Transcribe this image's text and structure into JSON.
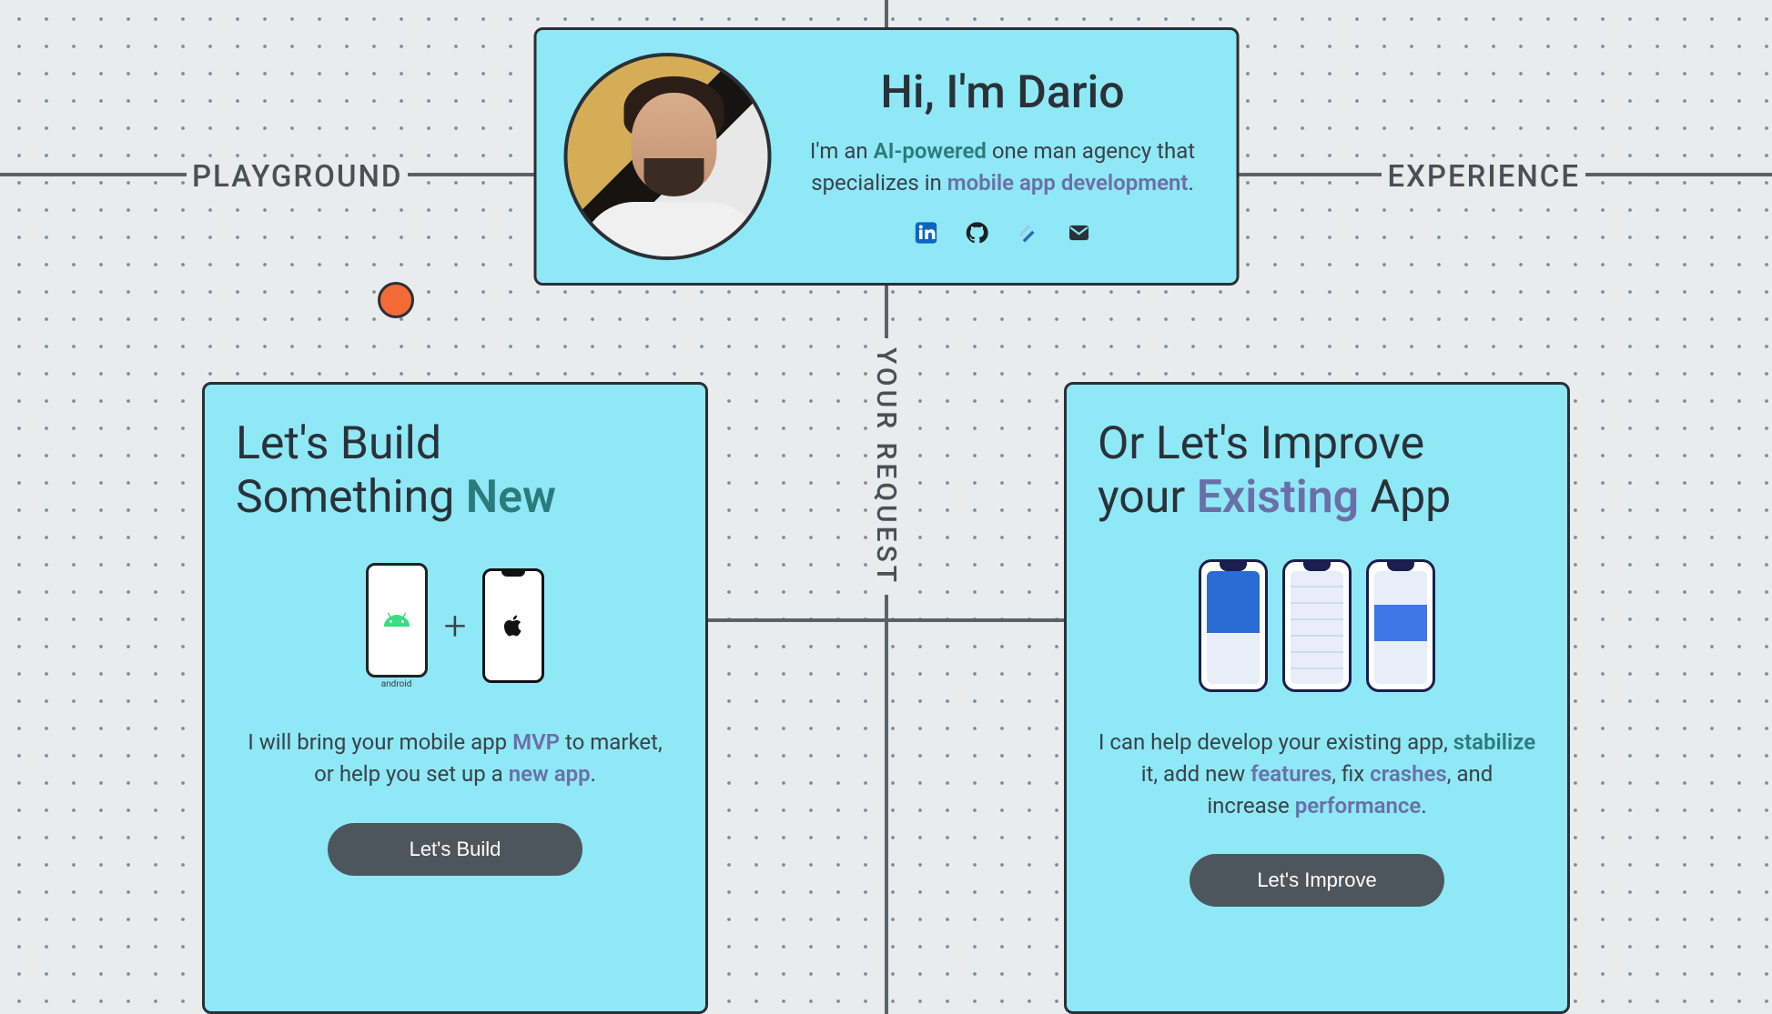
{
  "labels": {
    "playground": "PLAYGROUND",
    "experience": "EXPERIENCE",
    "your_request": "YOUR REQUEST"
  },
  "hero": {
    "title": "Hi, I'm Dario",
    "intro_pre": "I'm an ",
    "intro_hl1": "AI-powered",
    "intro_mid": " one man agency that specializes in ",
    "intro_hl2": "mobile app development",
    "intro_post": "."
  },
  "social": {
    "linkedin": "linkedin-icon",
    "github": "github-icon",
    "toptal": "toptal-icon",
    "email": "email-icon"
  },
  "build": {
    "title_line1": "Let's Build",
    "title_line2_pre": "Something ",
    "title_line2_accent": "New",
    "android_label": "android",
    "plus": "+",
    "desc_pre": "I will bring your mobile app ",
    "desc_kw1": "MVP",
    "desc_mid": " to market, or help you set up a ",
    "desc_kw2": "new app",
    "desc_post": ".",
    "button": "Let's Build"
  },
  "improve": {
    "title_line1": "Or Let's Improve",
    "title_line2_pre": "your ",
    "title_line2_accent": "Existing",
    "title_line2_post": " App",
    "desc_pre": "I can help develop your existing app, ",
    "desc_kw1": "stabilize",
    "desc_mid1": " it, add new ",
    "desc_kw2": "features",
    "desc_mid2": ", fix ",
    "desc_kw3": "crashes",
    "desc_mid3": ", and increase ",
    "desc_kw4": "performance",
    "desc_post": ".",
    "button": "Let's Improve"
  }
}
